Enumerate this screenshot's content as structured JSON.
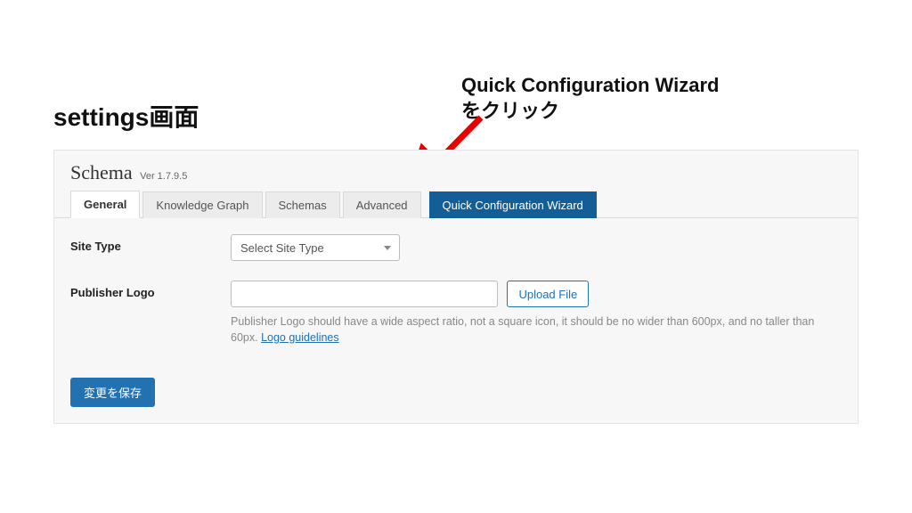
{
  "annotations": {
    "title": "settings画面",
    "callout_line1": "Quick Configuration Wizard",
    "callout_line2": "をクリック"
  },
  "panel": {
    "title": "Schema",
    "version": "Ver 1.7.9.5",
    "tabs": {
      "general": "General",
      "knowledge_graph": "Knowledge Graph",
      "schemas": "Schemas",
      "advanced": "Advanced",
      "wizard": "Quick Configuration Wizard"
    },
    "form": {
      "site_type_label": "Site Type",
      "site_type_placeholder": "Select Site Type",
      "publisher_logo_label": "Publisher Logo",
      "upload_button": "Upload File",
      "hint_text": "Publisher Logo should have a wide aspect ratio, not a square icon, it should be no wider than 600px, and no taller than 60px. ",
      "hint_link": "Logo guidelines"
    },
    "save_button": "変更を保存"
  }
}
